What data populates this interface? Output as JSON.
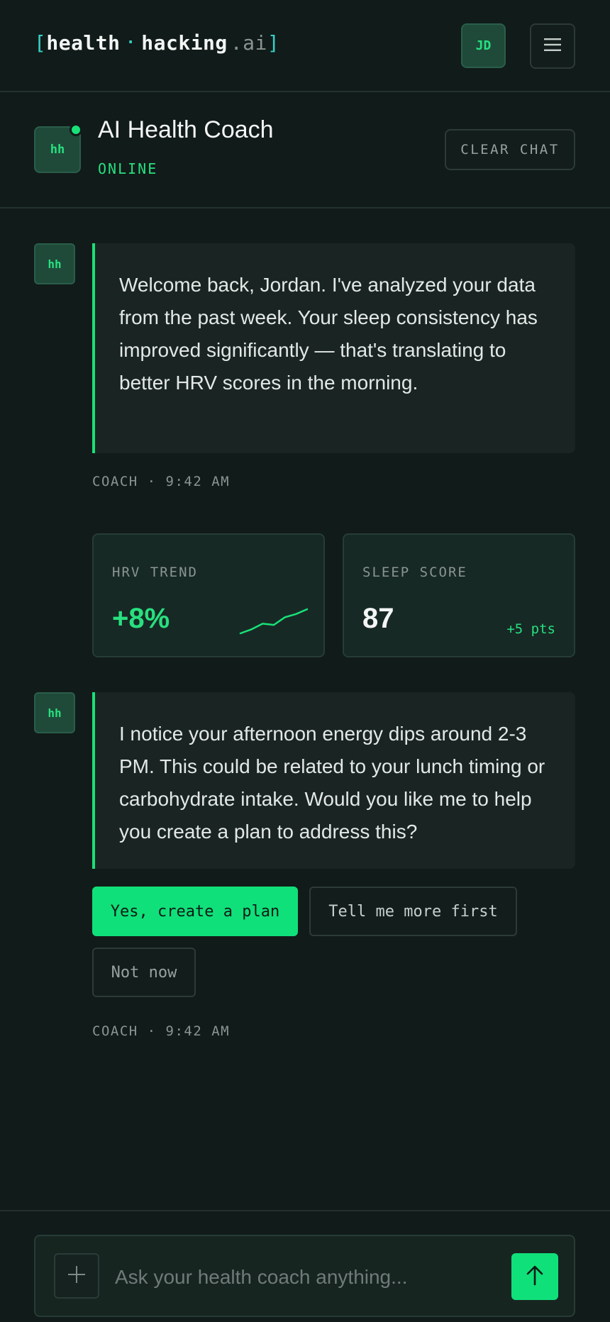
{
  "header": {
    "logo": {
      "bracket_open": "[",
      "word1": "health",
      "separator": "·",
      "word2": "hacking",
      "tld": ".ai",
      "bracket_close": "]"
    },
    "user_initials": "JD",
    "menu_icon": "hamburger-menu-icon"
  },
  "coach": {
    "avatar": "hh",
    "name": "AI Health Coach",
    "status": "ONLINE",
    "clear_label": "CLEAR CHAT"
  },
  "messages": [
    {
      "avatar": "hh",
      "text": "Welcome back, Jordan. I've analyzed your data from the past week. Your sleep consistency has improved significantly — that's translating to better HRV scores in the morning.",
      "meta": "COACH · 9:42 AM"
    },
    {
      "avatar": "hh",
      "text": "I notice your afternoon energy dips around 2-3 PM. This could be related to your lunch timing or carbohydrate intake. Would you like me to help you create a plan to address this?",
      "meta": "COACH · 9:42 AM"
    }
  ],
  "metrics": {
    "hrv": {
      "label": "HRV TREND",
      "value": "+8%",
      "sparkline": [
        10,
        20,
        34,
        31,
        50,
        58,
        70
      ],
      "sparkline_icon": "trend-sparkline"
    },
    "sleep": {
      "label": "SLEEP SCORE",
      "value": "87",
      "delta": "+5 pts"
    }
  },
  "quick_replies": {
    "yes": "Yes, create a plan",
    "more": "Tell me more first",
    "no": "Not now"
  },
  "composer": {
    "attach_icon": "plus-icon",
    "placeholder": "Ask your health coach anything...",
    "value": "",
    "send_icon": "arrow-up-icon"
  },
  "colors": {
    "background": "#111b19",
    "accent": "#10e07a",
    "logo_bracket": "#35d0c6"
  }
}
